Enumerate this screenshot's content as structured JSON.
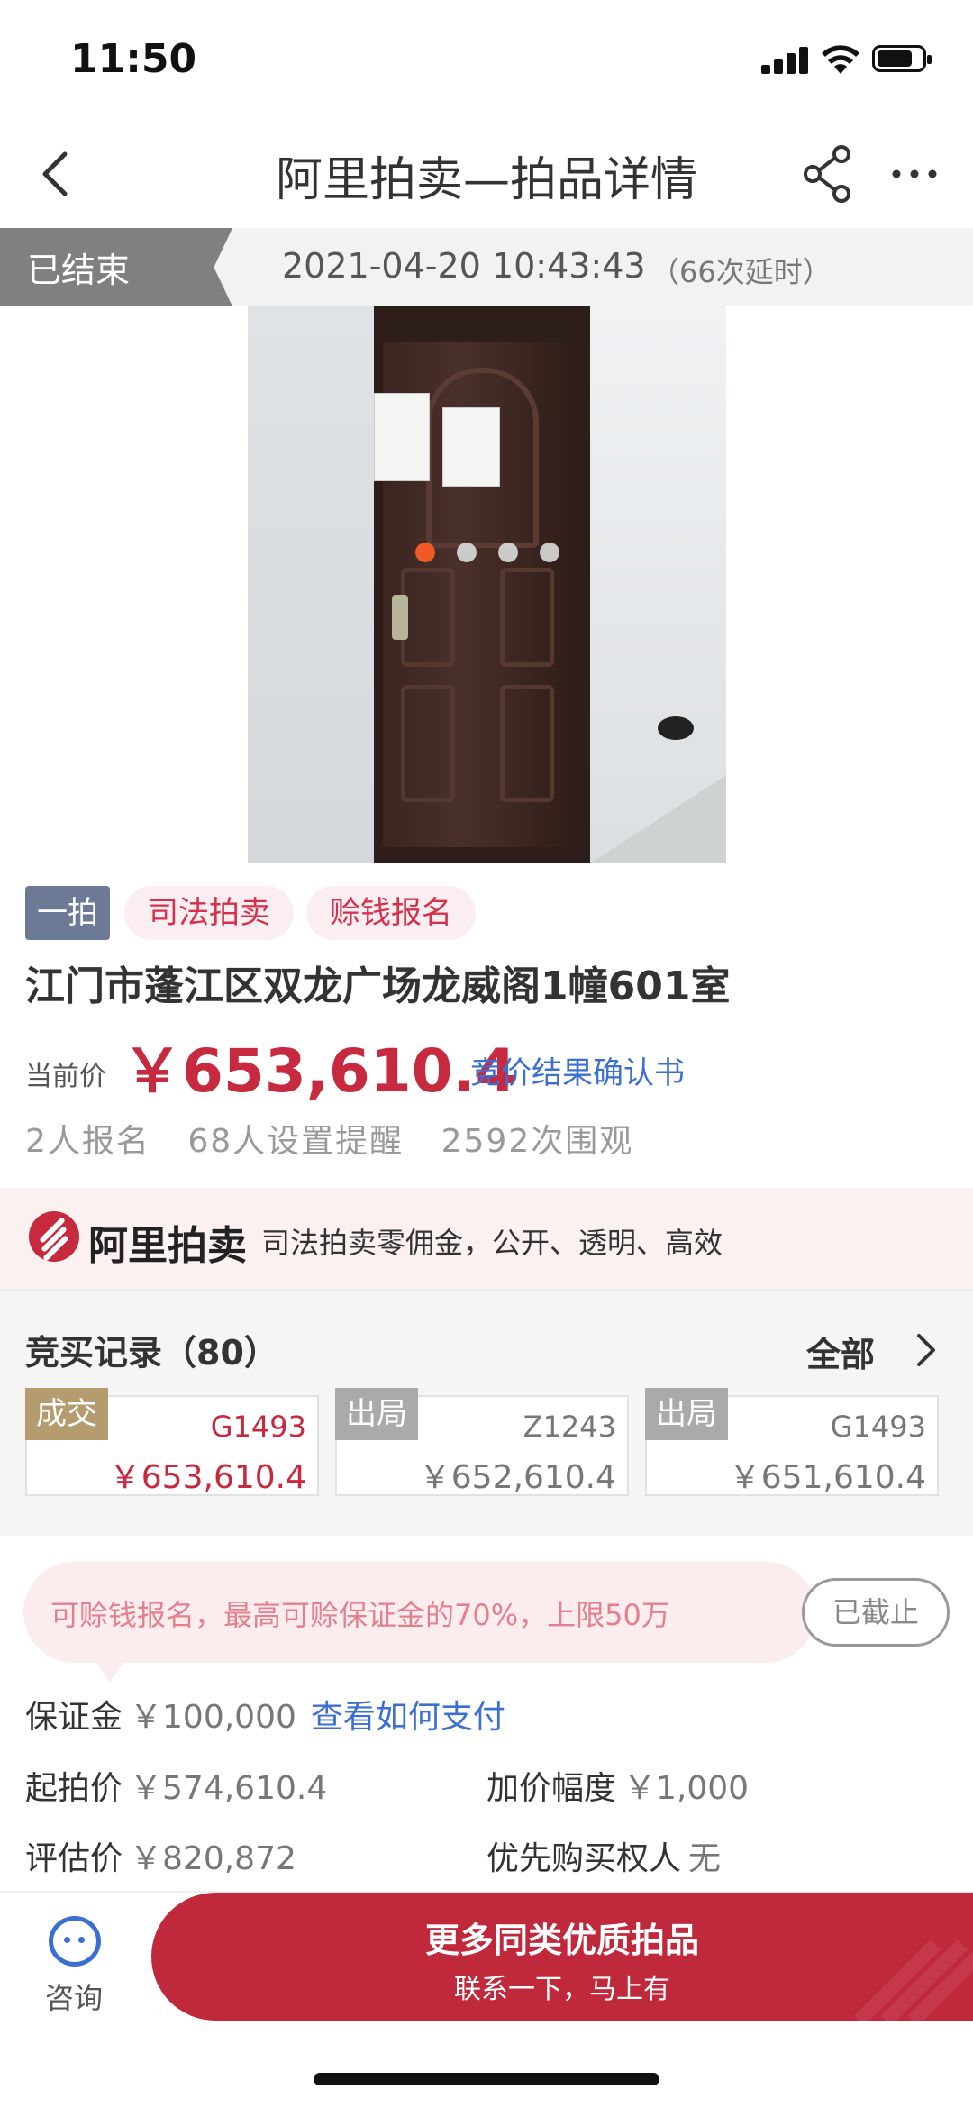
{
  "status_bar": {
    "time": "11:50"
  },
  "nav": {
    "title": "阿里拍卖—拍品详情"
  },
  "auction_status": {
    "label": "已结束",
    "end_time": "2021-04-20 10:43:43",
    "delay": "（66次延时）"
  },
  "gallery": {
    "total_images": 4,
    "active_index": 0
  },
  "tags": [
    "一拍",
    "司法拍卖",
    "赊钱报名"
  ],
  "item": {
    "title": "江门市蓬江区双龙广场龙威阁1幢601室",
    "price_label": "当前价",
    "current_price": "￥653,610.4",
    "confirm_link": "竞价结果确认书",
    "stats": [
      "2人报名",
      "68人设置提醒",
      "2592次围观"
    ]
  },
  "ali_banner": {
    "brand": "阿里拍卖",
    "slogan": "司法拍卖零佣金，公开、透明、高效"
  },
  "bid_records": {
    "heading": "竞买记录（80）",
    "all_label": "全部",
    "records": [
      {
        "status": "成交",
        "code": "G1493",
        "amount": "￥653,610.4",
        "status_color": "#b59c6e"
      },
      {
        "status": "出局",
        "code": "Z1243",
        "amount": "￥652,610.4",
        "status_color": "#aaaaaa"
      },
      {
        "status": "出局",
        "code": "G1493",
        "amount": "￥651,610.4",
        "status_color": "#aaaaaa"
      }
    ]
  },
  "credit": {
    "notice": "可赊钱报名，最高可赊保证金的70%，上限50万",
    "button": "已截止"
  },
  "details": {
    "deposit_label": "保证金",
    "deposit_value": "￥100,000",
    "deposit_link": "查看如何支付",
    "start_price_label": "起拍价",
    "start_price_value": "￥574,610.4",
    "increment_label": "加价幅度",
    "increment_value": "￥1,000",
    "appraisal_label": "评估价",
    "appraisal_value": "￥820,872",
    "priority_label": "优先购买权人",
    "priority_value": "无"
  },
  "bottom_bar": {
    "consult_label": "咨询",
    "cta_title": "更多同类优质拍品",
    "cta_sub": "联系一下，马上有"
  },
  "colors": {
    "accent_red": "#c72a3e",
    "link_blue": "#3b6fd1",
    "tag_gray_blue": "#6c7a95"
  }
}
